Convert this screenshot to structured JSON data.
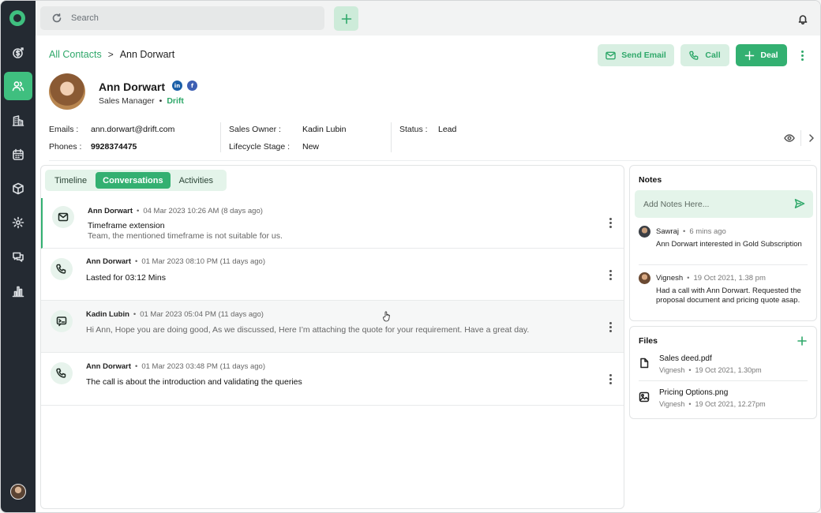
{
  "search": {
    "placeholder": "Search"
  },
  "breadcrumb": {
    "parent": "All Contacts",
    "separator": ">",
    "current": "Ann Dorwart"
  },
  "actions": {
    "send_email": "Send Email",
    "call": "Call",
    "deal": "Deal"
  },
  "contact": {
    "name": "Ann Dorwart",
    "social": {
      "linkedin": "in",
      "facebook": "f"
    },
    "role": "Sales Manager",
    "bullet": "•",
    "company": "Drift",
    "emails_label": "Emails :",
    "email": "ann.dorwart@drift.com",
    "phones_label": "Phones :",
    "phone": "9928374475",
    "owner_label": "Sales Owner :",
    "owner": "Kadin Lubin",
    "lifecycle_label": "Lifecycle Stage :",
    "lifecycle": "New",
    "status_label": "Status :",
    "status": "Lead"
  },
  "tabs": [
    {
      "label": "Timeline",
      "active": false
    },
    {
      "label": "Conversations",
      "active": true
    },
    {
      "label": "Activities",
      "active": false
    }
  ],
  "conversations": [
    {
      "icon": "mail-icon",
      "author": "Ann Dorwart",
      "sep": "•",
      "time": "04 Mar 2023 10:26 AM (8 days ago)",
      "title": "Timeframe extension",
      "body": "Team, the mentioned timeframe is not suitable for us."
    },
    {
      "icon": "phone-icon",
      "author": "Ann Dorwart",
      "sep": "•",
      "time": "01 Mar 2023 08:10 PM (11 days ago)",
      "title": "Lasted for 03:12 Mins",
      "body": ""
    },
    {
      "icon": "chat-icon",
      "author": "Kadin Lubin",
      "sep": "•",
      "time": "01 Mar 2023 05:04 PM (11 days ago)",
      "title": "",
      "body": "Hi Ann, Hope you are doing good, As we discussed, Here I’m attaching the quote for your requirement. Have a great day."
    },
    {
      "icon": "phone-icon",
      "author": "Ann Dorwart",
      "sep": "•",
      "time": "01 Mar 2023 03:48 PM (11 days ago)",
      "title": "The call is about the introduction and validating the queries",
      "body": ""
    }
  ],
  "notes": {
    "title": "Notes",
    "placeholder": "Add Notes Here...",
    "items": [
      {
        "author": "Sawraj",
        "sep": "•",
        "time": "6 mins ago",
        "text": "Ann Dorwart interested in Gold Subscription"
      },
      {
        "author": "Vignesh",
        "sep": "•",
        "time": "19 Oct 2021, 1.38 pm",
        "text": "Had a call with Ann Dorwart. Requested the proposal document and pricing quote asap."
      }
    ]
  },
  "files": {
    "title": "Files",
    "items": [
      {
        "name": "Sales deed.pdf",
        "author": "Vignesh",
        "sep": "•",
        "time": "19 Oct 2021, 1.30pm"
      },
      {
        "name": "Pricing Options.png",
        "author": "Vignesh",
        "sep": "•",
        "time": "19 Oct 2021, 12.27pm"
      }
    ]
  },
  "colors": {
    "accent": "#33b071",
    "accent_light": "#e4f4ea",
    "sidebar": "#242a32"
  }
}
